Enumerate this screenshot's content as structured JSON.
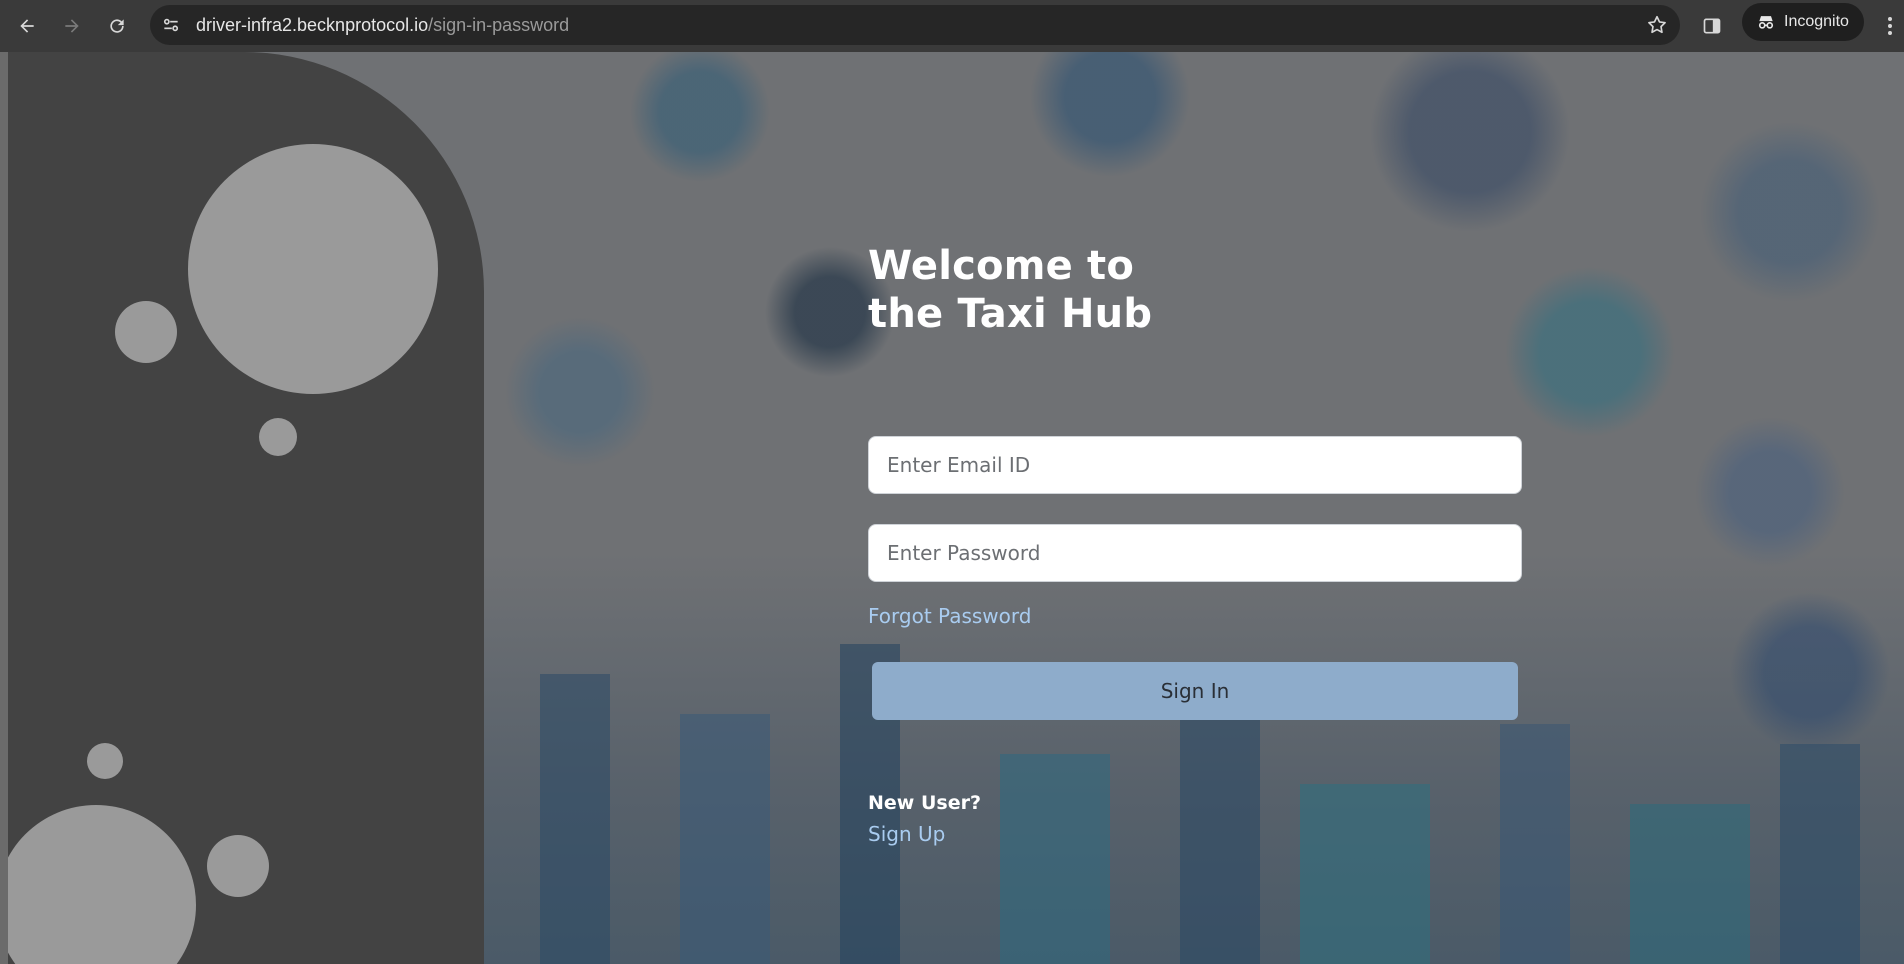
{
  "browser": {
    "url_host": "driver-infra2.becknprotocol.io",
    "url_path": "/sign-in-password",
    "incognito_label": "Incognito"
  },
  "icons": {
    "back": "back-arrow-icon",
    "forward": "forward-arrow-icon",
    "reload": "reload-icon",
    "site_info": "site-info-icon",
    "bookmark": "star-icon",
    "split": "side-panel-icon",
    "incognito": "incognito-icon",
    "menu": "kebab-menu-icon"
  },
  "login": {
    "title_line1": "Welcome to",
    "title_line2": "the Taxi Hub",
    "email_placeholder": "Enter Email ID",
    "password_placeholder": "Enter Password",
    "forgot_password": "Forgot Password",
    "sign_in": "Sign In",
    "new_user": "New User?",
    "sign_up": "Sign Up"
  },
  "colors": {
    "accent_link": "#a9ccf0",
    "button_bg": "#8eaccb",
    "panel_bg": "#434343",
    "bubble": "#9a9a9a"
  }
}
